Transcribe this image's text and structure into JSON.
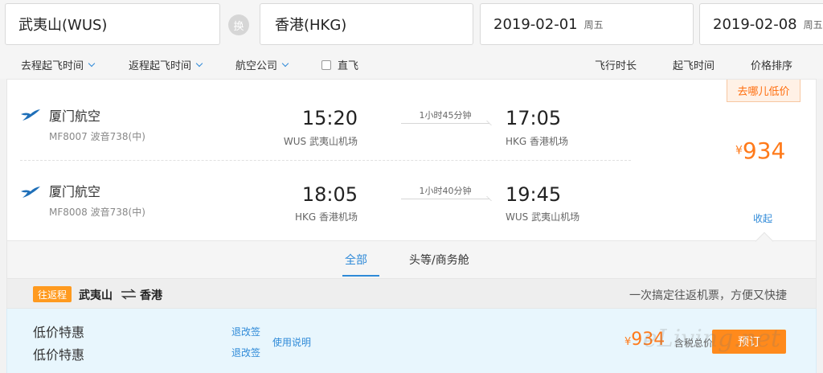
{
  "search": {
    "from": "武夷山(WUS)",
    "swap_label": "换",
    "to": "香港(HKG)",
    "depart_date": "2019-02-01",
    "depart_dow": "周五",
    "return_date": "2019-02-08",
    "return_dow": "周五"
  },
  "filters": {
    "outbound_time": "去程起飞时间",
    "return_time": "返程起飞时间",
    "airline": "航空公司",
    "direct": "直飞",
    "sort_duration": "飞行时长",
    "sort_depart": "起飞时间",
    "sort_price": "价格排序"
  },
  "flight": {
    "badge": "去哪儿低价",
    "currency": "¥",
    "price": "934",
    "collapse": "收起",
    "segments": [
      {
        "airline": "厦门航空",
        "flight_no": "MF8007 波音738(中)",
        "dep_time": "15:20",
        "dep_airport": "WUS 武夷山机场",
        "duration": "1小时45分钟",
        "arr_time": "17:05",
        "arr_airport": "HKG 香港机场"
      },
      {
        "airline": "厦门航空",
        "flight_no": "MF8008 波音738(中)",
        "dep_time": "18:05",
        "dep_airport": "HKG 香港机场",
        "duration": "1小时40分钟",
        "arr_time": "19:45",
        "arr_airport": "WUS 武夷山机场"
      }
    ]
  },
  "tabs": {
    "all": "全部",
    "first_business": "头等/商务舱"
  },
  "roundtrip": {
    "badge": "往返程",
    "from": "武夷山",
    "to": "香港",
    "slogan": "一次搞定往返机票，方便又快捷"
  },
  "fare": {
    "name_1": "低价特惠",
    "name_2": "低价特惠",
    "change_1": "退改签",
    "change_2": "退改签",
    "instructions": "使用说明",
    "currency": "¥",
    "price": "934",
    "tax_note": "含税总价",
    "book": "预订"
  },
  "watermark": "eLiving.net",
  "colors": {
    "accent_blue": "#2f8ad8",
    "price_orange": "#ff7a1a",
    "book_orange": "#ff8a1c"
  }
}
